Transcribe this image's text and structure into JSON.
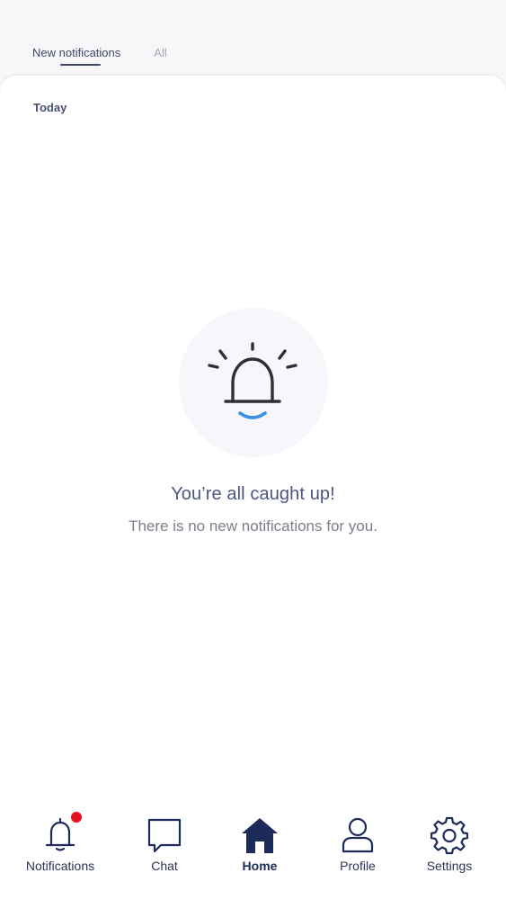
{
  "tabs": {
    "new_label": "New notifications",
    "all_label": "All"
  },
  "section": {
    "today_label": "Today"
  },
  "empty": {
    "title": "You’re all caught up!",
    "subtitle": "There is no new notifications for you."
  },
  "nav": {
    "items": [
      {
        "label": "Notifications",
        "icon": "bell-icon",
        "active": false,
        "badge": true
      },
      {
        "label": "Chat",
        "icon": "chat-bubble-icon",
        "active": false
      },
      {
        "label": "Home",
        "icon": "home-icon",
        "active": true
      },
      {
        "label": "Profile",
        "icon": "user-icon",
        "active": false
      },
      {
        "label": "Settings",
        "icon": "gear-icon",
        "active": false
      }
    ]
  },
  "colors": {
    "primary": "#1d2b5a",
    "text_title": "#4d5680",
    "badge": "#e8121f",
    "accent_smile": "#3d8fe0"
  }
}
